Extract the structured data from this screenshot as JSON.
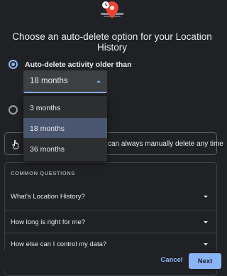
{
  "heading": "Choose an auto-delete option for your Location History",
  "illustration": {
    "icon": "location-pin-clock-icon",
    "pin_color": "#ea4335"
  },
  "options": [
    {
      "label": "Auto-delete activity older than",
      "checked": true
    },
    {
      "label": "",
      "checked": false
    }
  ],
  "select": {
    "value": "18 months",
    "options": [
      "3 months",
      "18 months",
      "36 months"
    ],
    "selected_index": 1
  },
  "info": {
    "icon": "hand-pointer-icon",
    "text": "can always manually delete any time"
  },
  "questions": {
    "title": "COMMON QUESTIONS",
    "items": [
      {
        "label": "What's Location History?"
      },
      {
        "label": "How long is right for me?"
      },
      {
        "label": "How else can I control my data?"
      }
    ]
  },
  "footer": {
    "cancel_label": "Cancel",
    "next_label": "Next"
  },
  "colors": {
    "accent": "#8ab4f8",
    "background": "#202124",
    "selected_option": "#4a5670"
  }
}
